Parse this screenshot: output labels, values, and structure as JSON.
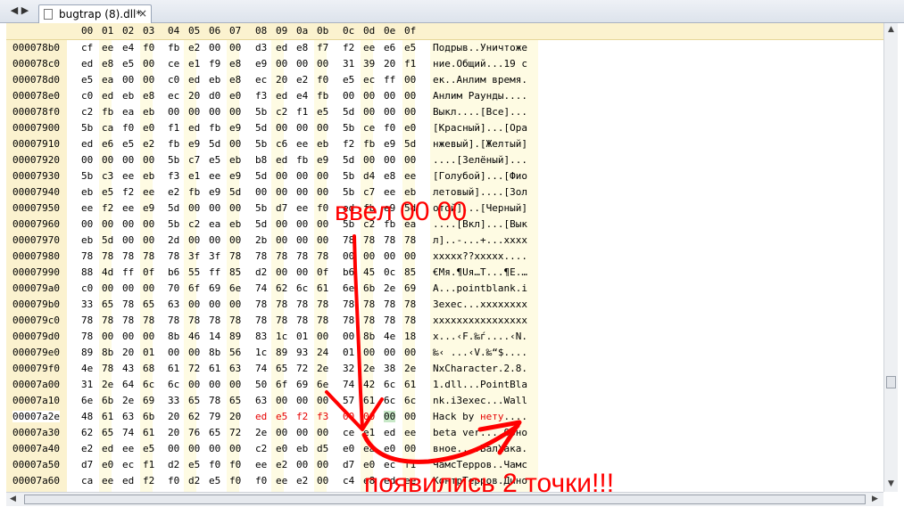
{
  "tab": {
    "title": "bugtrap (8).dll*",
    "close": "×",
    "nav_back": "◀",
    "nav_fwd": "▶"
  },
  "header": {
    "columns": [
      "00",
      "01",
      "02",
      "03",
      "04",
      "05",
      "06",
      "07",
      "08",
      "09",
      "0a",
      "0b",
      "0c",
      "0d",
      "0e",
      "0f"
    ]
  },
  "rows": [
    {
      "offset": "000078b0",
      "bytes": [
        "cf",
        "ee",
        "e4",
        "f0",
        "fb",
        "e2",
        "00",
        "00",
        "d3",
        "ed",
        "e8",
        "f7",
        "f2",
        "ee",
        "e6",
        "e5"
      ],
      "text": "Подрыв..Уничтоже"
    },
    {
      "offset": "000078c0",
      "bytes": [
        "ed",
        "e8",
        "e5",
        "00",
        "ce",
        "e1",
        "f9",
        "e8",
        "e9",
        "00",
        "00",
        "00",
        "31",
        "39",
        "20",
        "f1"
      ],
      "text": "ние.Общий...19 с"
    },
    {
      "offset": "000078d0",
      "bytes": [
        "e5",
        "ea",
        "00",
        "00",
        "c0",
        "ed",
        "eb",
        "e8",
        "ec",
        "20",
        "e2",
        "f0",
        "e5",
        "ec",
        "ff",
        "00"
      ],
      "text": "ек..Анлим время."
    },
    {
      "offset": "000078e0",
      "bytes": [
        "c0",
        "ed",
        "eb",
        "e8",
        "ec",
        "20",
        "d0",
        "e0",
        "f3",
        "ed",
        "e4",
        "fb",
        "00",
        "00",
        "00",
        "00"
      ],
      "text": "Анлим Раунды...."
    },
    {
      "offset": "000078f0",
      "bytes": [
        "c2",
        "fb",
        "ea",
        "eb",
        "00",
        "00",
        "00",
        "00",
        "5b",
        "c2",
        "f1",
        "e5",
        "5d",
        "00",
        "00",
        "00"
      ],
      "text": "Выкл....[Все]..."
    },
    {
      "offset": "00007900",
      "bytes": [
        "5b",
        "ca",
        "f0",
        "e0",
        "f1",
        "ed",
        "fb",
        "e9",
        "5d",
        "00",
        "00",
        "00",
        "5b",
        "ce",
        "f0",
        "e0"
      ],
      "text": "[Красный]...[Ора"
    },
    {
      "offset": "00007910",
      "bytes": [
        "ed",
        "e6",
        "e5",
        "e2",
        "fb",
        "e9",
        "5d",
        "00",
        "5b",
        "c6",
        "ee",
        "eb",
        "f2",
        "fb",
        "e9",
        "5d"
      ],
      "text": "нжевый].[Желтый]"
    },
    {
      "offset": "00007920",
      "bytes": [
        "00",
        "00",
        "00",
        "00",
        "5b",
        "c7",
        "e5",
        "eb",
        "b8",
        "ed",
        "fb",
        "e9",
        "5d",
        "00",
        "00",
        "00"
      ],
      "text": "....[Зелёный]..."
    },
    {
      "offset": "00007930",
      "bytes": [
        "5b",
        "c3",
        "ee",
        "eb",
        "f3",
        "e1",
        "ee",
        "e9",
        "5d",
        "00",
        "00",
        "00",
        "5b",
        "d4",
        "e8",
        "ee"
      ],
      "text": "[Голубой]...[Фио"
    },
    {
      "offset": "00007940",
      "bytes": [
        "eb",
        "e5",
        "f2",
        "ee",
        "e2",
        "fb",
        "e9",
        "5d",
        "00",
        "00",
        "00",
        "00",
        "5b",
        "c7",
        "ee",
        "eb"
      ],
      "text": "летовый]....[Зол"
    },
    {
      "offset": "00007950",
      "bytes": [
        "ee",
        "f2",
        "ee",
        "e9",
        "5d",
        "00",
        "00",
        "00",
        "5b",
        "d7",
        "ee",
        "f0",
        "ed",
        "fb",
        "e9",
        "5d"
      ],
      "text": "отой]...[Черный]"
    },
    {
      "offset": "00007960",
      "bytes": [
        "00",
        "00",
        "00",
        "00",
        "5b",
        "c2",
        "ea",
        "eb",
        "5d",
        "00",
        "00",
        "00",
        "5b",
        "c2",
        "fb",
        "ea"
      ],
      "text": "....[Вкл]...[Вык"
    },
    {
      "offset": "00007970",
      "bytes": [
        "eb",
        "5d",
        "00",
        "00",
        "2d",
        "00",
        "00",
        "00",
        "2b",
        "00",
        "00",
        "00",
        "78",
        "78",
        "78",
        "78"
      ],
      "text": "л]..-...+...xxxx"
    },
    {
      "offset": "00007980",
      "bytes": [
        "78",
        "78",
        "78",
        "78",
        "78",
        "3f",
        "3f",
        "78",
        "78",
        "78",
        "78",
        "78",
        "00",
        "00",
        "00",
        "00"
      ],
      "text": "xxxxx??xxxxx...."
    },
    {
      "offset": "00007990",
      "bytes": [
        "88",
        "4d",
        "ff",
        "0f",
        "b6",
        "55",
        "ff",
        "85",
        "d2",
        "00",
        "00",
        "0f",
        "b6",
        "45",
        "0c",
        "85"
      ],
      "text": "€Мя.¶Uя…Т...¶E.…"
    },
    {
      "offset": "000079a0",
      "bytes": [
        "c0",
        "00",
        "00",
        "00",
        "70",
        "6f",
        "69",
        "6e",
        "74",
        "62",
        "6c",
        "61",
        "6e",
        "6b",
        "2e",
        "69"
      ],
      "text": "А...pointblank.i"
    },
    {
      "offset": "000079b0",
      "bytes": [
        "33",
        "65",
        "78",
        "65",
        "63",
        "00",
        "00",
        "00",
        "78",
        "78",
        "78",
        "78",
        "78",
        "78",
        "78",
        "78"
      ],
      "text": "3exec...xxxxxxxx"
    },
    {
      "offset": "000079c0",
      "bytes": [
        "78",
        "78",
        "78",
        "78",
        "78",
        "78",
        "78",
        "78",
        "78",
        "78",
        "78",
        "78",
        "78",
        "78",
        "78",
        "78"
      ],
      "text": "xxxxxxxxxxxxxxxx"
    },
    {
      "offset": "000079d0",
      "bytes": [
        "78",
        "00",
        "00",
        "00",
        "8b",
        "46",
        "14",
        "89",
        "83",
        "1c",
        "01",
        "00",
        "00",
        "8b",
        "4e",
        "18"
      ],
      "text": "x...‹F.‰ѓ....‹N."
    },
    {
      "offset": "000079e0",
      "bytes": [
        "89",
        "8b",
        "20",
        "01",
        "00",
        "00",
        "8b",
        "56",
        "1c",
        "89",
        "93",
        "24",
        "01",
        "00",
        "00",
        "00"
      ],
      "text": "‰‹ ...‹V.‰“$...."
    },
    {
      "offset": "000079f0",
      "bytes": [
        "4e",
        "78",
        "43",
        "68",
        "61",
        "72",
        "61",
        "63",
        "74",
        "65",
        "72",
        "2e",
        "32",
        "2e",
        "38",
        "2e"
      ],
      "text": "NxCharacter.2.8."
    },
    {
      "offset": "00007a00",
      "bytes": [
        "31",
        "2e",
        "64",
        "6c",
        "6c",
        "00",
        "00",
        "00",
        "50",
        "6f",
        "69",
        "6e",
        "74",
        "42",
        "6c",
        "61"
      ],
      "text": "1.dll...PointBla"
    },
    {
      "offset": "00007a10",
      "bytes": [
        "6e",
        "6b",
        "2e",
        "69",
        "33",
        "65",
        "78",
        "65",
        "63",
        "00",
        "00",
        "00",
        "57",
        "61",
        "6c",
        "6c"
      ],
      "text": "nk.i3exec...Wall"
    },
    {
      "offset": "00007a2e",
      "bytes": [
        "48",
        "61",
        "63",
        "6b",
        "20",
        "62",
        "79",
        "20",
        "ed",
        "e5",
        "f2",
        "f3",
        "00",
        "00",
        "00",
        "00"
      ],
      "text": "Hack by нету....",
      "current": true,
      "red_from": 8,
      "red_to": 13,
      "sel": 14
    },
    {
      "offset": "00007a30",
      "bytes": [
        "62",
        "65",
        "74",
        "61",
        "20",
        "76",
        "65",
        "72",
        "2e",
        "00",
        "00",
        "00",
        "ce",
        "e1",
        "ed",
        "ee"
      ],
      "text": "beta ver....Обно"
    },
    {
      "offset": "00007a40",
      "bytes": [
        "e2",
        "ed",
        "ee",
        "e5",
        "00",
        "00",
        "00",
        "00",
        "c2",
        "e0",
        "eb",
        "d5",
        "e0",
        "ea",
        "e0",
        "00"
      ],
      "text": "вное....ВалХака."
    },
    {
      "offset": "00007a50",
      "bytes": [
        "d7",
        "e0",
        "ec",
        "f1",
        "d2",
        "e5",
        "f0",
        "f0",
        "ee",
        "e2",
        "00",
        "00",
        "d7",
        "e0",
        "ec",
        "f1"
      ],
      "text": "ЧамсТерров..Чамс"
    },
    {
      "offset": "00007a60",
      "bytes": [
        "ca",
        "ee",
        "ed",
        "f2",
        "f0",
        "d2",
        "e5",
        "f0",
        "f0",
        "ee",
        "e2",
        "00",
        "c4",
        "e8",
        "ed",
        "ee"
      ],
      "text": "КонтрТерров.Дино"
    }
  ],
  "annotations": {
    "note1": "ввел 00 00",
    "note2": "появились 2 точки!!!"
  },
  "colors": {
    "annotation": "#ff0000",
    "highlight_red": "#e60000",
    "selection": "#c7e8c7",
    "header_bg": "#fbf2cf"
  }
}
